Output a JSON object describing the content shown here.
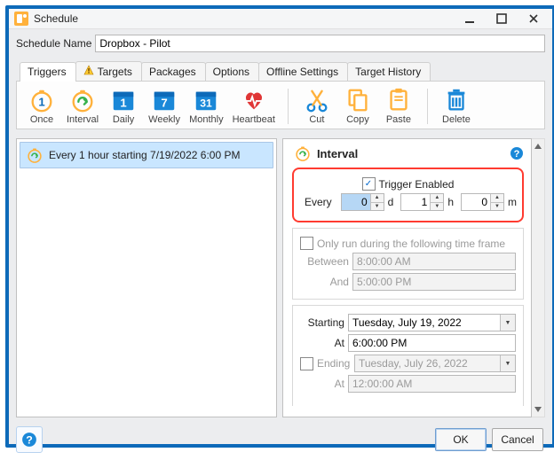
{
  "titlebar": {
    "title": "Schedule"
  },
  "fields": {
    "schedule_name_label": "Schedule Name",
    "schedule_name_value": "Dropbox - Pilot"
  },
  "tabs": [
    "Triggers",
    "Targets",
    "Packages",
    "Options",
    "Offline Settings",
    "Target History"
  ],
  "toolbar": [
    "Once",
    "Interval",
    "Daily",
    "Weekly",
    "Monthly",
    "Heartbeat",
    "Cut",
    "Copy",
    "Paste",
    "Delete"
  ],
  "list": [
    "Every 1 hour starting 7/19/2022 6:00 PM"
  ],
  "panel": {
    "title": "Interval",
    "enabled_label": "Trigger Enabled",
    "enabled_checked": true,
    "every_label": "Every",
    "every": {
      "d": "0",
      "h": "1",
      "m": "0"
    },
    "units": {
      "d": "d",
      "h": "h",
      "m": "m"
    },
    "timeframe_label": "Only run during the following time frame",
    "timeframe_checked": false,
    "between_label": "Between",
    "between_value": "8:00:00 AM",
    "and_label": "And",
    "and_value": "5:00:00 PM",
    "starting_label": "Starting",
    "starting_value": "Tuesday, July 19, 2022",
    "at_label": "At",
    "starting_time": "6:00:00 PM",
    "ending_label": "Ending",
    "ending_checked": false,
    "ending_value": "Tuesday, July 26, 2022",
    "ending_time": "12:00:00 AM"
  },
  "footer": {
    "ok": "OK",
    "cancel": "Cancel"
  }
}
